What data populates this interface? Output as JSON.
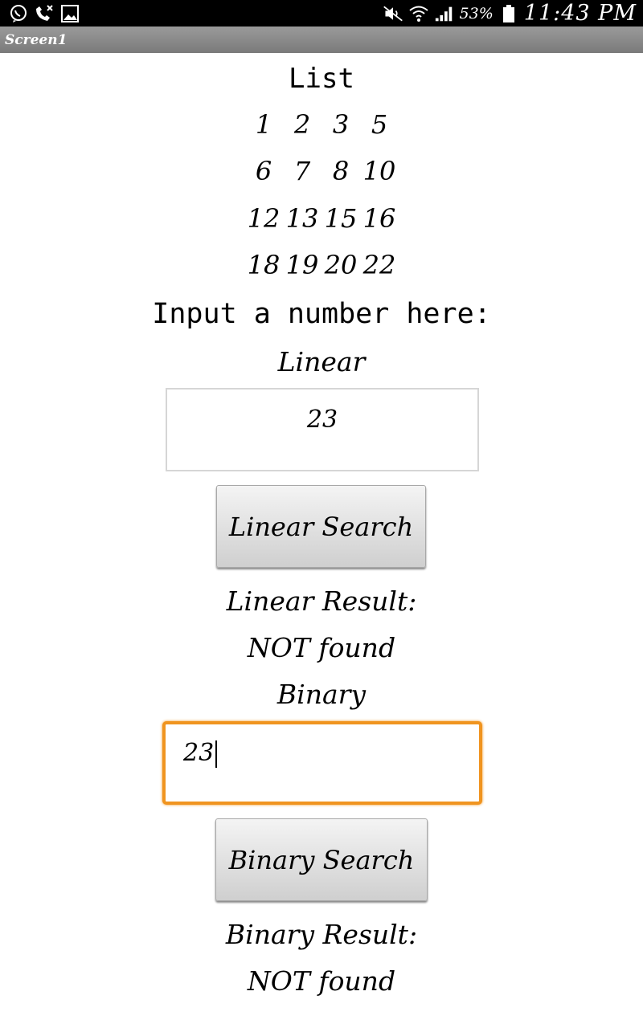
{
  "status_bar": {
    "battery": "53%",
    "time": "11:43 PM",
    "icons": [
      "viber-icon",
      "missed-call-icon",
      "image-icon",
      "mute-icon",
      "wifi-icon",
      "signal-icon",
      "battery-icon"
    ]
  },
  "window": {
    "title": "Screen1"
  },
  "list": {
    "title": "List",
    "rows": [
      [
        "1",
        "2",
        "3",
        "5"
      ],
      [
        "6",
        "7",
        "8",
        "10"
      ],
      [
        "12",
        "13",
        "15",
        "16"
      ],
      [
        "18",
        "19",
        "20",
        "22"
      ]
    ]
  },
  "prompt": "Input a number here:",
  "linear": {
    "label": "Linear",
    "input_value": "23",
    "button_label": "Linear Search",
    "result_label": "Linear Result:",
    "result_value": "NOT found"
  },
  "binary": {
    "label": "Binary",
    "input_value": "23",
    "button_label": "Binary Search",
    "result_label": "Binary Result:",
    "result_value": "NOT found"
  },
  "colors": {
    "focus_border": "#f0941f",
    "status_bar": "#000000",
    "title_bar": "#8a8a8a"
  }
}
